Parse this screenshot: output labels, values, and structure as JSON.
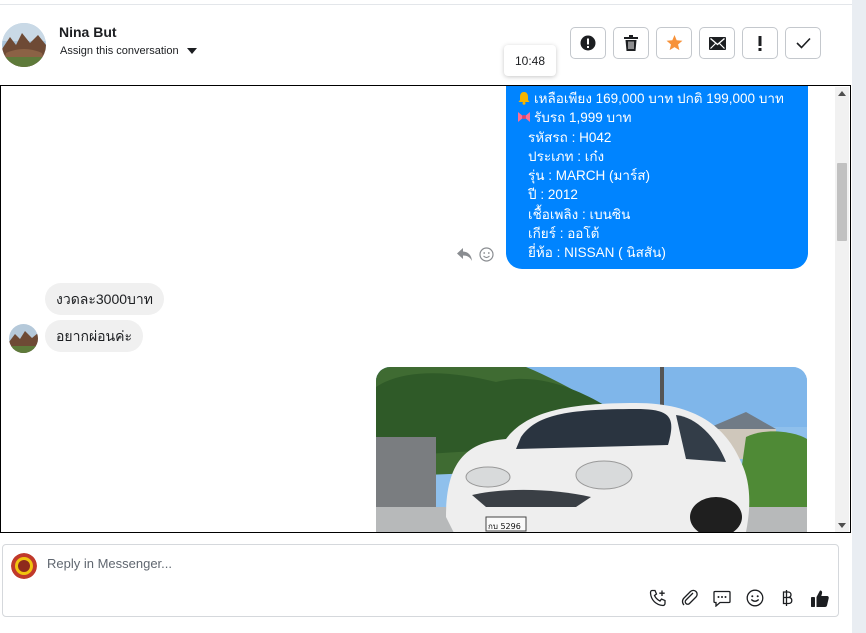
{
  "header": {
    "contact_name": "Nina But",
    "assign_label": "Assign this conversation",
    "tooltip_time": "10:48",
    "actions": [
      {
        "name": "spam",
        "icon": "alert-circle-icon"
      },
      {
        "name": "delete",
        "icon": "trash-icon"
      },
      {
        "name": "star",
        "icon": "star-icon",
        "color": "#f7923a"
      },
      {
        "name": "mark-unread",
        "icon": "envelope-icon"
      },
      {
        "name": "follow-up",
        "icon": "exclamation-icon"
      },
      {
        "name": "done",
        "icon": "check-icon"
      }
    ]
  },
  "conversation": {
    "outgoing_text": {
      "lines": [
        {
          "emoji": "bell-icon",
          "text": "เหลือเพียง 169,000 บาท ปกติ 199,000 บาท"
        },
        {
          "emoji": "ribbon-icon",
          "text": "รับรถ 1,999 บาท"
        },
        {
          "text": "รหัสรถ : H042"
        },
        {
          "text": "ประเภท : เก๋ง"
        },
        {
          "text": "รุ่น : MARCH (มาร์ส)"
        },
        {
          "text": "ปี : 2012"
        },
        {
          "text": "เชื้อเพลิง : เบนซิน"
        },
        {
          "text": "เกียร์ : ออโต้"
        },
        {
          "text": "ยี่ห้อ : NISSAN ( นิสสัน)"
        }
      ],
      "color": "#0084ff"
    },
    "incoming": [
      {
        "text": "งวดละ3000บาท"
      },
      {
        "text": "อยากผ่อนค่ะ"
      }
    ],
    "car_image": {
      "plate": "กบ 5296"
    }
  },
  "reply": {
    "placeholder": "Reply in Messenger...",
    "tools": [
      "add-call-icon",
      "attachment-icon",
      "saved-reply-icon",
      "emoji-icon",
      "baht-icon",
      "like-icon"
    ]
  }
}
